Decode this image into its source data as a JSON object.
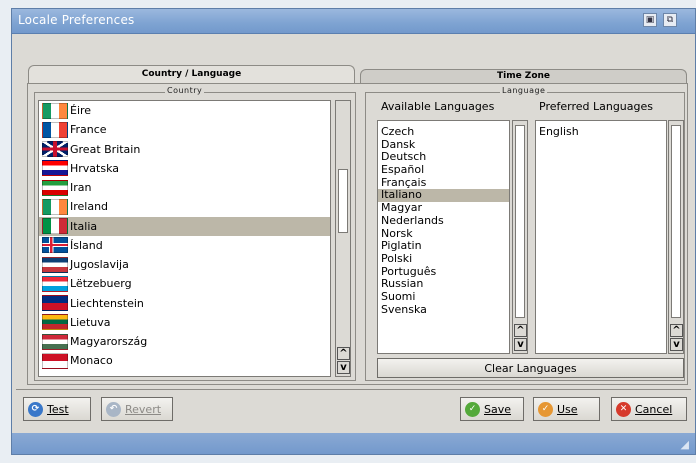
{
  "window": {
    "title": "Locale Preferences"
  },
  "tabs": [
    {
      "label": "Country / Language",
      "active": true
    },
    {
      "label": "Time Zone",
      "active": false
    }
  ],
  "country_group": {
    "label": "Country",
    "selected": "Italia",
    "items": [
      {
        "name": "Éire",
        "flag": "ireland-flag-icon"
      },
      {
        "name": "France",
        "flag": "france-flag-icon"
      },
      {
        "name": "Great Britain",
        "flag": "uk-flag-icon"
      },
      {
        "name": "Hrvatska",
        "flag": "croatia-flag-icon"
      },
      {
        "name": "Iran",
        "flag": "iran-flag-icon"
      },
      {
        "name": "Ireland",
        "flag": "ireland-flag-icon"
      },
      {
        "name": "Italia",
        "flag": "italy-flag-icon"
      },
      {
        "name": "Ísland",
        "flag": "iceland-flag-icon"
      },
      {
        "name": "Jugoslavija",
        "flag": "yugoslavia-flag-icon"
      },
      {
        "name": "Lëtzebuerg",
        "flag": "luxembourg-flag-icon"
      },
      {
        "name": "Liechtenstein",
        "flag": "liechtenstein-flag-icon"
      },
      {
        "name": "Lietuva",
        "flag": "lithuania-flag-icon"
      },
      {
        "name": "Magyarország",
        "flag": "hungary-flag-icon"
      },
      {
        "name": "Monaco",
        "flag": "monaco-flag-icon"
      }
    ]
  },
  "language_group": {
    "label": "Language",
    "available_heading": "Available Languages",
    "preferred_heading": "Preferred Languages",
    "available": [
      "Czech",
      "Dansk",
      "Deutsch",
      "Español",
      "Français",
      "Italiano",
      "Magyar",
      "Nederlands",
      "Norsk",
      "Piglatin",
      "Polski",
      "Português",
      "Russian",
      "Suomi",
      "Svenska"
    ],
    "selected_available": "Italiano",
    "preferred": [
      "English"
    ],
    "clear_button": "Clear Languages"
  },
  "scroll_arrows": {
    "up": "^",
    "down": "v"
  },
  "buttons": {
    "test": "Test",
    "revert": "Revert",
    "save": "Save",
    "use": "Use",
    "cancel": "Cancel"
  },
  "colors": {
    "titlebar": "#7ea3d2",
    "selection": "#bcb7a8",
    "panel": "#dcdad5"
  }
}
